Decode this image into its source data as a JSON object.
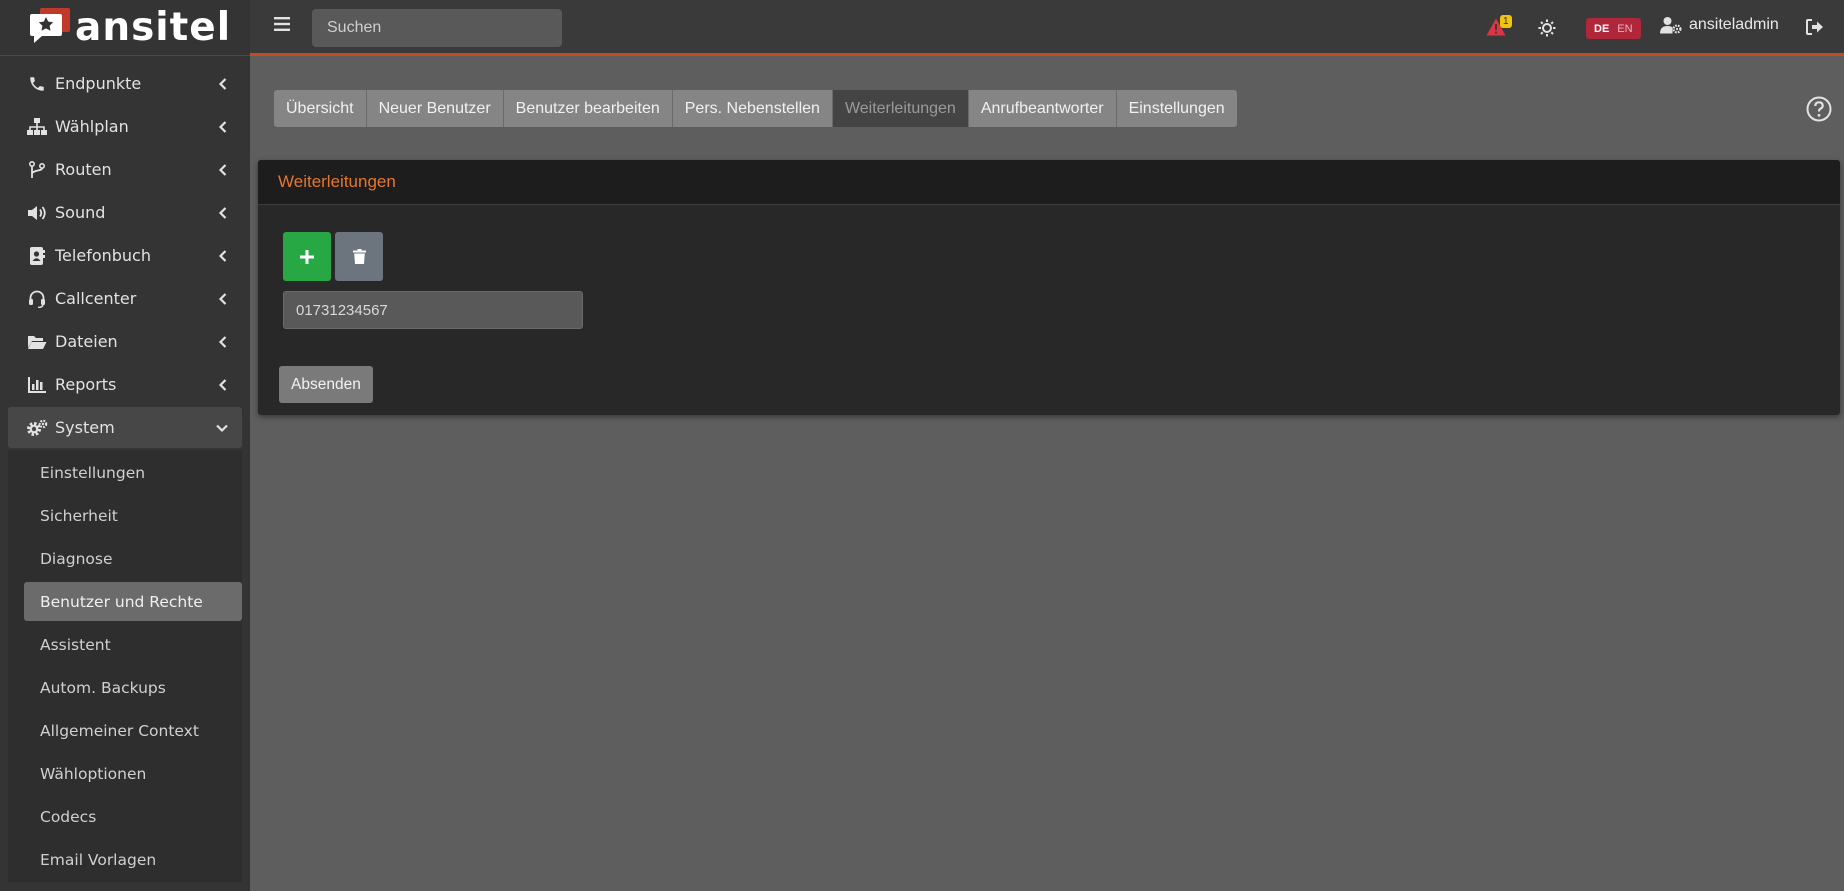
{
  "brand": {
    "name": "ansitel"
  },
  "topbar": {
    "search_placeholder": "Suchen",
    "alert_count": "1",
    "lang_de": "DE",
    "lang_en": "EN",
    "username": "ansiteladmin"
  },
  "sidebar": {
    "items": [
      {
        "label": "Endpunkte",
        "icon": "phone-icon"
      },
      {
        "label": "Wählplan",
        "icon": "sitemap-icon"
      },
      {
        "label": "Routen",
        "icon": "route-icon"
      },
      {
        "label": "Sound",
        "icon": "volume-icon"
      },
      {
        "label": "Telefonbuch",
        "icon": "address-book-icon"
      },
      {
        "label": "Callcenter",
        "icon": "headset-icon"
      },
      {
        "label": "Dateien",
        "icon": "folder-open-icon"
      },
      {
        "label": "Reports",
        "icon": "chart-bar-icon"
      },
      {
        "label": "System",
        "icon": "cogs-icon"
      }
    ],
    "submenu": [
      "Einstellungen",
      "Sicherheit",
      "Diagnose",
      "Benutzer und Rechte",
      "Assistent",
      "Autom. Backups",
      "Allgemeiner Context",
      "Wähloptionen",
      "Codecs",
      "Email Vorlagen"
    ]
  },
  "tabs": [
    "Übersicht",
    "Neuer Benutzer",
    "Benutzer bearbeiten",
    "Pers. Nebenstellen",
    "Weiterleitungen",
    "Anrufbeantworter",
    "Einstellungen"
  ],
  "card": {
    "title": "Weiterleitungen",
    "forward_number": "01731234567",
    "submit_label": "Absenden"
  },
  "colors": {
    "accent": "#c74b1d",
    "title_orange": "#e4772e",
    "add_green": "#28a745",
    "delete_gray": "#6c757d",
    "alert_red": "#dc3545",
    "badge_yellow": "#f1c40f"
  }
}
